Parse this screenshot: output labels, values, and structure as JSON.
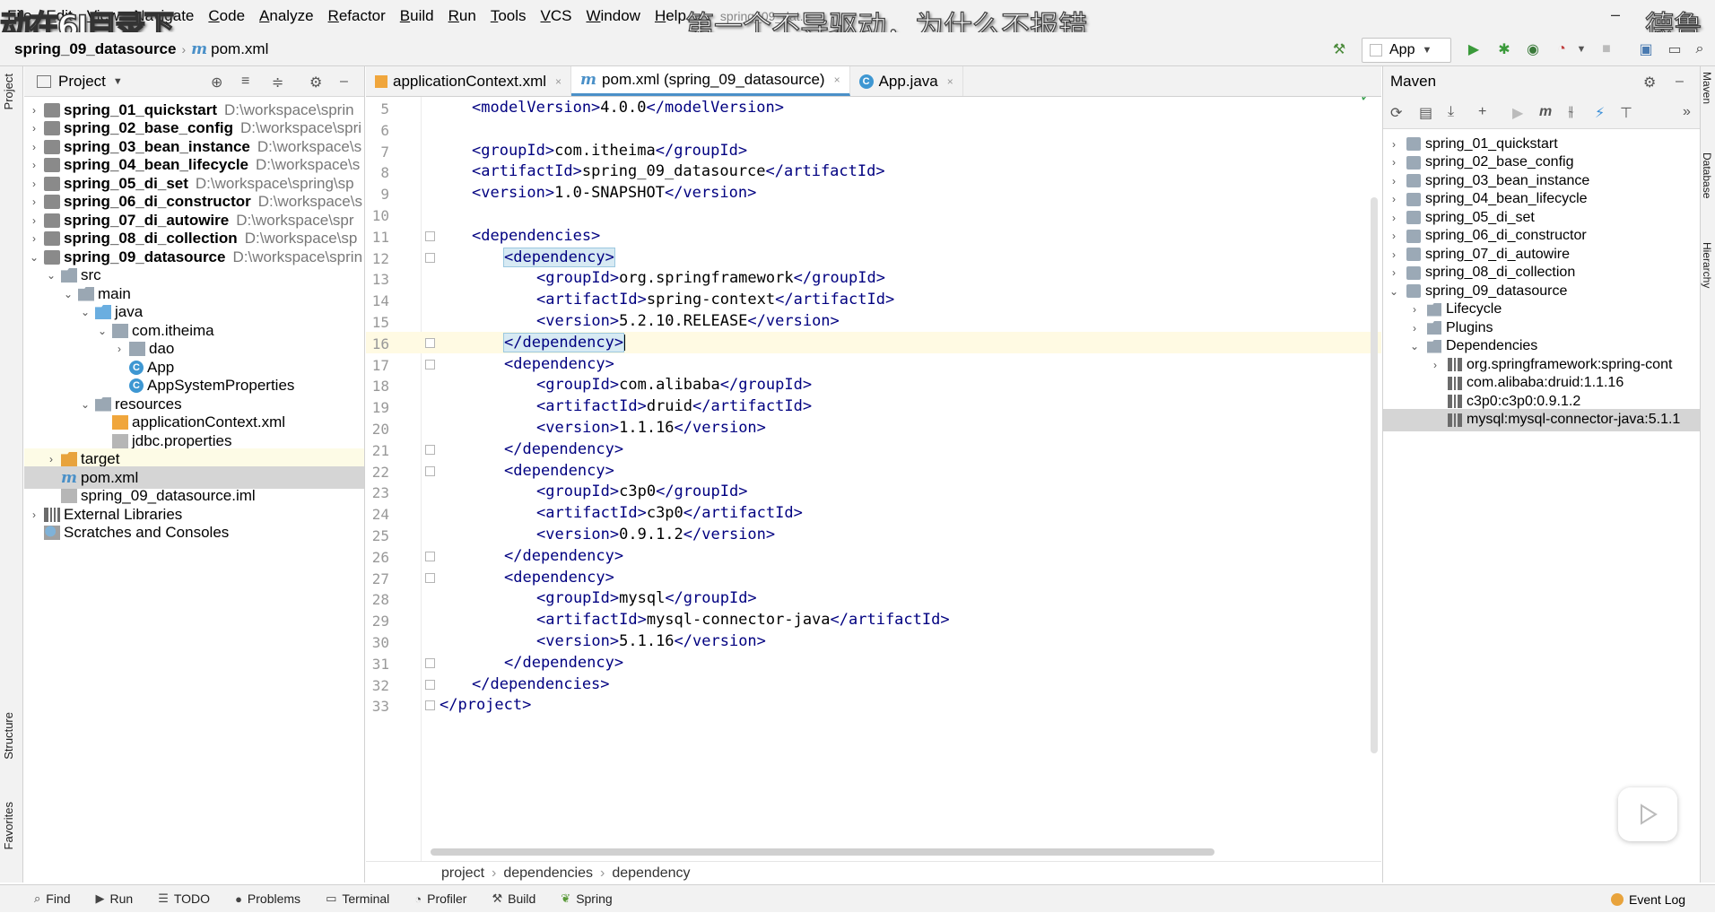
{
  "overlay": {
    "left_caption": "动在6J目录下",
    "center_caption": "第一个不导驱动，为什么不报错",
    "right_caption": "德鲁"
  },
  "menu": [
    "File",
    "Edit",
    "View",
    "Navigate",
    "Code",
    "Analyze",
    "Refactor",
    "Build",
    "Run",
    "Tools",
    "VCS",
    "Window",
    "Help"
  ],
  "window_title_fragment": "spring_09_dat...",
  "nav": {
    "project": "spring_09_datasource",
    "file": "pom.xml",
    "file_icon": "m"
  },
  "toolbar": {
    "run_config": "App"
  },
  "left_stripe": {
    "project_tab": "Project",
    "structure_tab": "Structure",
    "favorites_tab": "Favorites"
  },
  "project_panel": {
    "title": "Project",
    "tree": [
      {
        "indent": 0,
        "arrow": "›",
        "icon": "module",
        "name": "spring_01_quickstart",
        "bold": true,
        "path": "D:\\workspace\\sprin"
      },
      {
        "indent": 0,
        "arrow": "›",
        "icon": "module",
        "name": "spring_02_base_config",
        "bold": true,
        "path": "D:\\workspace\\spri"
      },
      {
        "indent": 0,
        "arrow": "›",
        "icon": "module",
        "name": "spring_03_bean_instance",
        "bold": true,
        "path": "D:\\workspace\\s"
      },
      {
        "indent": 0,
        "arrow": "›",
        "icon": "module",
        "name": "spring_04_bean_lifecycle",
        "bold": true,
        "path": "D:\\workspace\\s"
      },
      {
        "indent": 0,
        "arrow": "›",
        "icon": "module",
        "name": "spring_05_di_set",
        "bold": true,
        "path": "D:\\workspace\\spring\\sp"
      },
      {
        "indent": 0,
        "arrow": "›",
        "icon": "module",
        "name": "spring_06_di_constructor",
        "bold": true,
        "path": "D:\\workspace\\s"
      },
      {
        "indent": 0,
        "arrow": "›",
        "icon": "module",
        "name": "spring_07_di_autowire",
        "bold": true,
        "path": "D:\\workspace\\spr"
      },
      {
        "indent": 0,
        "arrow": "›",
        "icon": "module",
        "name": "spring_08_di_collection",
        "bold": true,
        "path": "D:\\workspace\\sp"
      },
      {
        "indent": 0,
        "arrow": "⌄",
        "icon": "module",
        "name": "spring_09_datasource",
        "bold": true,
        "path": "D:\\workspace\\sprin"
      },
      {
        "indent": 1,
        "arrow": "⌄",
        "icon": "folder",
        "name": "src",
        "bold": false,
        "path": ""
      },
      {
        "indent": 2,
        "arrow": "⌄",
        "icon": "folder",
        "name": "main",
        "bold": false,
        "path": ""
      },
      {
        "indent": 3,
        "arrow": "⌄",
        "icon": "folder-blue",
        "name": "java",
        "bold": false,
        "path": ""
      },
      {
        "indent": 4,
        "arrow": "⌄",
        "icon": "pkg",
        "name": "com.itheima",
        "bold": false,
        "path": ""
      },
      {
        "indent": 5,
        "arrow": "›",
        "icon": "pkg",
        "name": "dao",
        "bold": false,
        "path": ""
      },
      {
        "indent": 5,
        "arrow": "",
        "icon": "class",
        "name": "App",
        "bold": false,
        "path": ""
      },
      {
        "indent": 5,
        "arrow": "",
        "icon": "class",
        "name": "AppSystemProperties",
        "bold": false,
        "path": ""
      },
      {
        "indent": 3,
        "arrow": "⌄",
        "icon": "folder",
        "name": "resources",
        "bold": false,
        "path": ""
      },
      {
        "indent": 4,
        "arrow": "",
        "icon": "xml",
        "name": "applicationContext.xml",
        "bold": false,
        "path": ""
      },
      {
        "indent": 4,
        "arrow": "",
        "icon": "prop",
        "name": "jdbc.properties",
        "bold": false,
        "path": ""
      },
      {
        "indent": 1,
        "arrow": "›",
        "icon": "folder-orange",
        "name": "target",
        "bold": false,
        "path": ""
      },
      {
        "indent": 1,
        "arrow": "",
        "icon": "m",
        "name": "pom.xml",
        "bold": false,
        "path": ""
      },
      {
        "indent": 1,
        "arrow": "",
        "icon": "prop",
        "name": "spring_09_datasource.iml",
        "bold": false,
        "path": ""
      },
      {
        "indent": 0,
        "arrow": "›",
        "icon": "lib",
        "name": "External Libraries",
        "bold": false,
        "path": ""
      },
      {
        "indent": 0,
        "arrow": "",
        "icon": "scratch",
        "name": "Scratches and Consoles",
        "bold": false,
        "path": ""
      }
    ]
  },
  "editor": {
    "tabs": [
      {
        "label": "applicationContext.xml",
        "icon": "xml",
        "active": false
      },
      {
        "label": "pom.xml (spring_09_datasource)",
        "icon": "m",
        "active": true
      },
      {
        "label": "App.java",
        "icon": "class",
        "active": false
      }
    ],
    "lines": [
      {
        "n": "5",
        "indent": 1,
        "open": "<modelVersion>",
        "text": "4.0.0",
        "close": "</modelVersion>"
      },
      {
        "n": "6",
        "indent": 0,
        "open": "",
        "text": "",
        "close": ""
      },
      {
        "n": "7",
        "indent": 1,
        "open": "<groupId>",
        "text": "com.itheima",
        "close": "</groupId>"
      },
      {
        "n": "8",
        "indent": 1,
        "open": "<artifactId>",
        "text": "spring_09_datasource",
        "close": "</artifactId>"
      },
      {
        "n": "9",
        "indent": 1,
        "open": "<version>",
        "text": "1.0-SNAPSHOT",
        "close": "</version>"
      },
      {
        "n": "10",
        "indent": 0,
        "open": "",
        "text": "",
        "close": ""
      },
      {
        "n": "11",
        "indent": 1,
        "open": "<dependencies>",
        "text": "",
        "close": ""
      },
      {
        "n": "12",
        "indent": 2,
        "open": "<dependency>",
        "text": "",
        "close": ""
      },
      {
        "n": "13",
        "indent": 3,
        "open": "<groupId>",
        "text": "org.springframework",
        "close": "</groupId>"
      },
      {
        "n": "14",
        "indent": 3,
        "open": "<artifactId>",
        "text": "spring-context",
        "close": "</artifactId>"
      },
      {
        "n": "15",
        "indent": 3,
        "open": "<version>",
        "text": "5.2.10.RELEASE",
        "close": "</version>"
      },
      {
        "n": "16",
        "indent": 2,
        "open": "</dependency>",
        "text": "",
        "close": ""
      },
      {
        "n": "17",
        "indent": 2,
        "open": "<dependency>",
        "text": "",
        "close": ""
      },
      {
        "n": "18",
        "indent": 3,
        "open": "<groupId>",
        "text": "com.alibaba",
        "close": "</groupId>"
      },
      {
        "n": "19",
        "indent": 3,
        "open": "<artifactId>",
        "text": "druid",
        "close": "</artifactId>"
      },
      {
        "n": "20",
        "indent": 3,
        "open": "<version>",
        "text": "1.1.16",
        "close": "</version>"
      },
      {
        "n": "21",
        "indent": 2,
        "open": "</dependency>",
        "text": "",
        "close": ""
      },
      {
        "n": "22",
        "indent": 2,
        "open": "<dependency>",
        "text": "",
        "close": ""
      },
      {
        "n": "23",
        "indent": 3,
        "open": "<groupId>",
        "text": "c3p0",
        "close": "</groupId>"
      },
      {
        "n": "24",
        "indent": 3,
        "open": "<artifactId>",
        "text": "c3p0",
        "close": "</artifactId>"
      },
      {
        "n": "25",
        "indent": 3,
        "open": "<version>",
        "text": "0.9.1.2",
        "close": "</version>"
      },
      {
        "n": "26",
        "indent": 2,
        "open": "</dependency>",
        "text": "",
        "close": ""
      },
      {
        "n": "27",
        "indent": 2,
        "open": "<dependency>",
        "text": "",
        "close": ""
      },
      {
        "n": "28",
        "indent": 3,
        "open": "<groupId>",
        "text": "mysql",
        "close": "</groupId>"
      },
      {
        "n": "29",
        "indent": 3,
        "open": "<artifactId>",
        "text": "mysql-connector-java",
        "close": "</artifactId>"
      },
      {
        "n": "30",
        "indent": 3,
        "open": "<version>",
        "text": "5.1.16",
        "close": "</version>"
      },
      {
        "n": "31",
        "indent": 2,
        "open": "</dependency>",
        "text": "",
        "close": ""
      },
      {
        "n": "32",
        "indent": 1,
        "open": "</dependencies>",
        "text": "",
        "close": ""
      },
      {
        "n": "33",
        "indent": 0,
        "open": "</project>",
        "text": "",
        "close": ""
      }
    ],
    "breadcrumbs": [
      "project",
      "dependencies",
      "dependency"
    ]
  },
  "maven": {
    "title": "Maven",
    "tree": [
      {
        "indent": 0,
        "arrow": "›",
        "icon": "mvn",
        "label": "spring_01_quickstart"
      },
      {
        "indent": 0,
        "arrow": "›",
        "icon": "mvn",
        "label": "spring_02_base_config"
      },
      {
        "indent": 0,
        "arrow": "›",
        "icon": "mvn",
        "label": "spring_03_bean_instance"
      },
      {
        "indent": 0,
        "arrow": "›",
        "icon": "mvn",
        "label": "spring_04_bean_lifecycle"
      },
      {
        "indent": 0,
        "arrow": "›",
        "icon": "mvn",
        "label": "spring_05_di_set"
      },
      {
        "indent": 0,
        "arrow": "›",
        "icon": "mvn",
        "label": "spring_06_di_constructor"
      },
      {
        "indent": 0,
        "arrow": "›",
        "icon": "mvn",
        "label": "spring_07_di_autowire"
      },
      {
        "indent": 0,
        "arrow": "›",
        "icon": "mvn",
        "label": "spring_08_di_collection"
      },
      {
        "indent": 0,
        "arrow": "⌄",
        "icon": "mvn",
        "label": "spring_09_datasource"
      },
      {
        "indent": 1,
        "arrow": "›",
        "icon": "gear-folder",
        "label": "Lifecycle"
      },
      {
        "indent": 1,
        "arrow": "›",
        "icon": "gear-folder",
        "label": "Plugins"
      },
      {
        "indent": 1,
        "arrow": "⌄",
        "icon": "lib-folder",
        "label": "Dependencies"
      },
      {
        "indent": 2,
        "arrow": "›",
        "icon": "lib",
        "label": "org.springframework:spring-cont"
      },
      {
        "indent": 2,
        "arrow": "",
        "icon": "lib",
        "label": "com.alibaba:druid:1.1.16"
      },
      {
        "indent": 2,
        "arrow": "",
        "icon": "lib",
        "label": "c3p0:c3p0:0.9.1.2"
      },
      {
        "indent": 2,
        "arrow": "",
        "icon": "lib",
        "label": "mysql:mysql-connector-java:5.1.1",
        "selected": true
      }
    ]
  },
  "right_stripe": {
    "maven_tab": "Maven",
    "database_tab": "Database",
    "hierarchy_tab": "Hierarchy"
  },
  "bottom_bar": [
    "Find",
    "Run",
    "TODO",
    "Problems",
    "Terminal",
    "Profiler",
    "Build",
    "Spring"
  ],
  "event_log": "Event Log",
  "colors": {
    "accent": "#4a90c8",
    "tag": "#000080",
    "current_line": "#fffae3"
  }
}
